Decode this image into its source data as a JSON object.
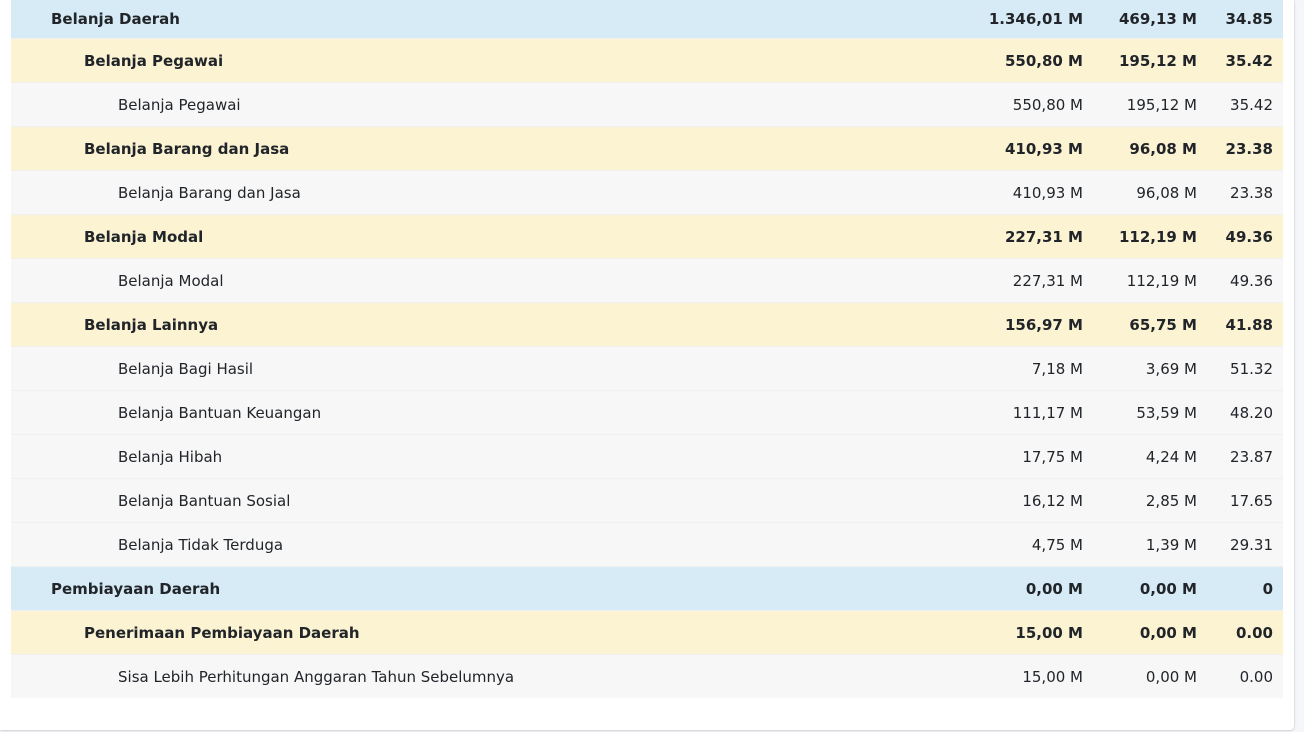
{
  "rows": [
    {
      "level": 1,
      "name": "Belanja Daerah",
      "anggaran": "1.346,01 M",
      "realisasi": "469,13 M",
      "persen": "34.85"
    },
    {
      "level": 2,
      "name": "Belanja Pegawai",
      "anggaran": "550,80 M",
      "realisasi": "195,12 M",
      "persen": "35.42"
    },
    {
      "level": 3,
      "name": "Belanja Pegawai",
      "anggaran": "550,80 M",
      "realisasi": "195,12 M",
      "persen": "35.42"
    },
    {
      "level": 2,
      "name": "Belanja Barang dan Jasa",
      "anggaran": "410,93 M",
      "realisasi": "96,08 M",
      "persen": "23.38"
    },
    {
      "level": 3,
      "name": "Belanja Barang dan Jasa",
      "anggaran": "410,93 M",
      "realisasi": "96,08 M",
      "persen": "23.38"
    },
    {
      "level": 2,
      "name": "Belanja Modal",
      "anggaran": "227,31 M",
      "realisasi": "112,19 M",
      "persen": "49.36"
    },
    {
      "level": 3,
      "name": "Belanja Modal",
      "anggaran": "227,31 M",
      "realisasi": "112,19 M",
      "persen": "49.36"
    },
    {
      "level": 2,
      "name": "Belanja Lainnya",
      "anggaran": "156,97 M",
      "realisasi": "65,75 M",
      "persen": "41.88"
    },
    {
      "level": 3,
      "name": "Belanja Bagi Hasil",
      "anggaran": "7,18 M",
      "realisasi": "3,69 M",
      "persen": "51.32"
    },
    {
      "level": 3,
      "name": "Belanja Bantuan Keuangan",
      "anggaran": "111,17 M",
      "realisasi": "53,59 M",
      "persen": "48.20"
    },
    {
      "level": 3,
      "name": "Belanja Hibah",
      "anggaran": "17,75 M",
      "realisasi": "4,24 M",
      "persen": "23.87"
    },
    {
      "level": 3,
      "name": "Belanja Bantuan Sosial",
      "anggaran": "16,12 M",
      "realisasi": "2,85 M",
      "persen": "17.65"
    },
    {
      "level": 3,
      "name": "Belanja Tidak Terduga",
      "anggaran": "4,75 M",
      "realisasi": "1,39 M",
      "persen": "29.31"
    },
    {
      "level": 1,
      "name": "Pembiayaan Daerah",
      "anggaran": "0,00 M",
      "realisasi": "0,00 M",
      "persen": "0"
    },
    {
      "level": 2,
      "name": "Penerimaan Pembiayaan Daerah",
      "anggaran": "15,00 M",
      "realisasi": "0,00 M",
      "persen": "0.00"
    },
    {
      "level": 3,
      "name": "Sisa Lebih Perhitungan Anggaran Tahun Sebelumnya",
      "anggaran": "15,00 M",
      "realisasi": "0,00 M",
      "persen": "0.00"
    }
  ],
  "colors": {
    "level1_bg": "#d7ebf6",
    "level2_bg": "#fbf3d2",
    "level3_bg": "#f7f7f8"
  }
}
